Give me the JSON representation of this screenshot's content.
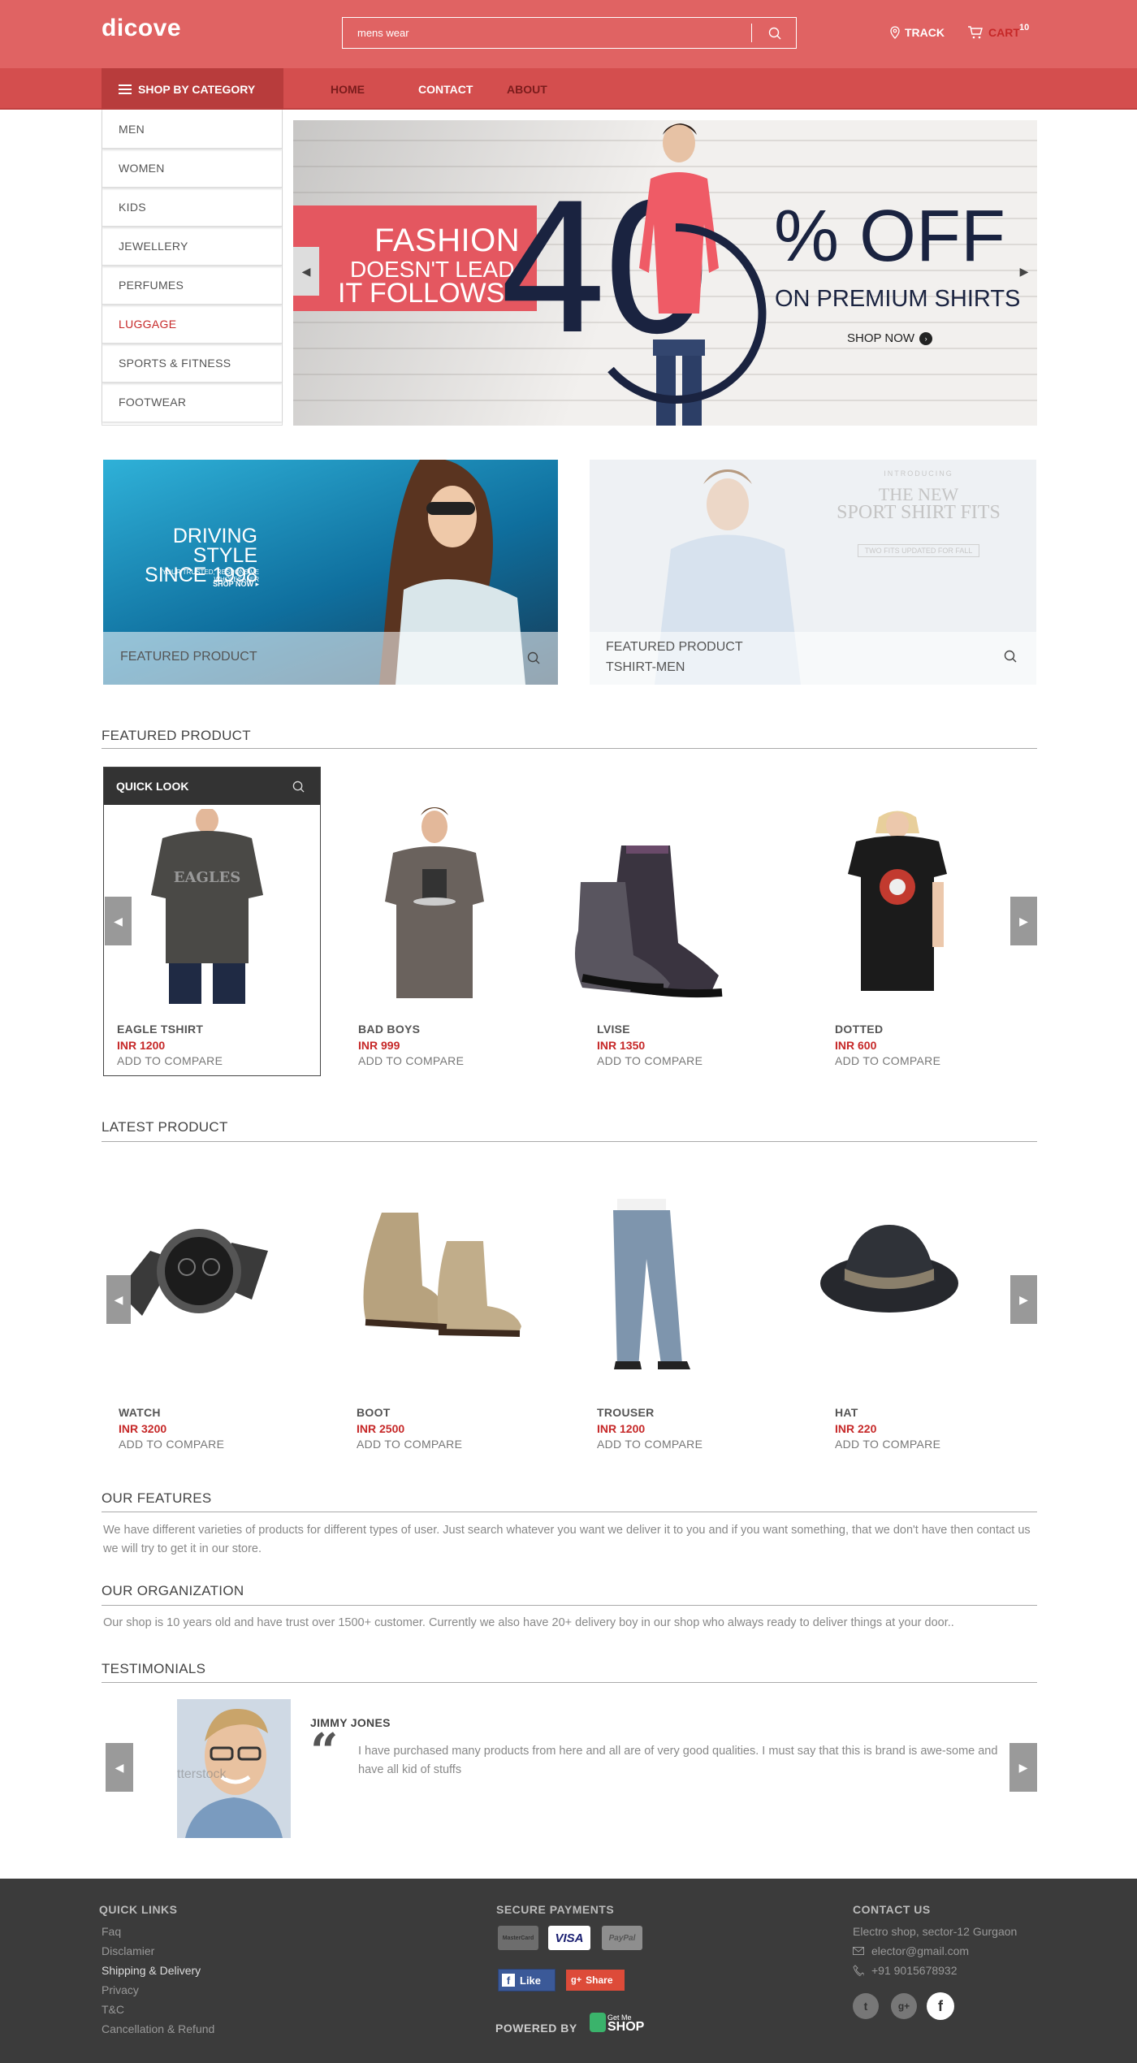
{
  "header": {
    "logo": "dicove",
    "search_value": "mens wear",
    "track": "TRACK",
    "cart": "CART",
    "cart_count": "10"
  },
  "nav": {
    "category": "SHOP BY CATEGORY",
    "items": [
      "HOME",
      "CONTACT",
      "ABOUT"
    ]
  },
  "categories": [
    "MEN",
    "WOMEN",
    "KIDS",
    "JEWELLERY",
    "PERFUMES",
    "LUGGAGE",
    "SPORTS & FITNESS",
    "FOOTWEAR"
  ],
  "hero": {
    "line1": "FASHION",
    "line2": "DOESN'T LEAD;",
    "line3": "IT FOLLOWS",
    "big": "40",
    "off": "% OFF",
    "premium": "ON PREMIUM SHIRTS",
    "shop": "SHOP NOW"
  },
  "banners": [
    {
      "title1": "DRIVING STYLE",
      "title2": "SINCE 1998",
      "small": "YOUR TRUSTED, RESPONSIVE WHOLESALER",
      "cta": "SHOP NOW ▸",
      "caption": "FEATURED PRODUCT"
    },
    {
      "introducing": "INTRODUCING",
      "title1": "THE NEW",
      "title2": "SPORT SHIRT FITS",
      "small": "TWO FITS UPDATED FOR FALL",
      "caption1": "FEATURED PRODUCT",
      "caption2": "TSHIRT-MEN"
    }
  ],
  "featured": {
    "title": "FEATURED PRODUCT",
    "quicklook": "QUICK LOOK",
    "products": [
      {
        "name": "EAGLE TSHIRT",
        "price": "INR 1200",
        "compare": "ADD TO COMPARE"
      },
      {
        "name": "BAD BOYS",
        "price": "INR 999",
        "compare": "ADD TO COMPARE"
      },
      {
        "name": "LVISE",
        "price": "INR 1350",
        "compare": "ADD TO COMPARE"
      },
      {
        "name": "DOTTED",
        "price": "INR 600",
        "compare": "ADD TO COMPARE"
      }
    ]
  },
  "latest": {
    "title": "LATEST PRODUCT",
    "products": [
      {
        "name": "WATCH",
        "price": "INR 3200",
        "compare": "ADD TO COMPARE"
      },
      {
        "name": "BOOT",
        "price": "INR 2500",
        "compare": "ADD TO COMPARE"
      },
      {
        "name": "TROUSER",
        "price": "INR 1200",
        "compare": "ADD TO COMPARE"
      },
      {
        "name": "HAT",
        "price": "INR 220",
        "compare": "ADD TO COMPARE"
      }
    ]
  },
  "features": {
    "title": "OUR FEATURES",
    "text": "We have different varieties of products for different types of user. Just search whatever you want we deliver it to you and if you want something, that we don't have then contact us we will try to get it in our store."
  },
  "organization": {
    "title": "OUR ORGANIZATION",
    "text": "Our shop is 10 years old and have trust over 1500+ customer. Currently we also have 20+ delivery boy in our shop who always ready to deliver things at your door.."
  },
  "testimonials": {
    "title": "TESTIMONIALS",
    "name": "JIMMY JONES",
    "quote": "I have purchased many products from here and all are of very good qualities. I must say that this is brand is awe-some and have all kid of stuffs",
    "watermark": "tterstock"
  },
  "footer": {
    "quick_links_title": "QUICK LINKS",
    "links": [
      "Faq",
      "Disclamier",
      "Shipping & Delivery",
      "Privacy",
      "T&C",
      "Cancellation & Refund"
    ],
    "payments_title": "SECURE PAYMENTS",
    "cards": [
      "MasterCard",
      "VISA",
      "PayPal"
    ],
    "like": "Like",
    "share": "Share",
    "powered": "POWERED BY",
    "brand_small": "Get Me",
    "brand": "SHOP",
    "contact_title": "CONTACT US",
    "address": "Electro shop, sector-12 Gurgaon",
    "email": "elector@gmail.com",
    "phone": "+91 9015678932"
  },
  "colors": {
    "brand": "#e06363",
    "nav": "#d44e4e",
    "accent": "#c62828",
    "footer": "#3b3b3b"
  }
}
